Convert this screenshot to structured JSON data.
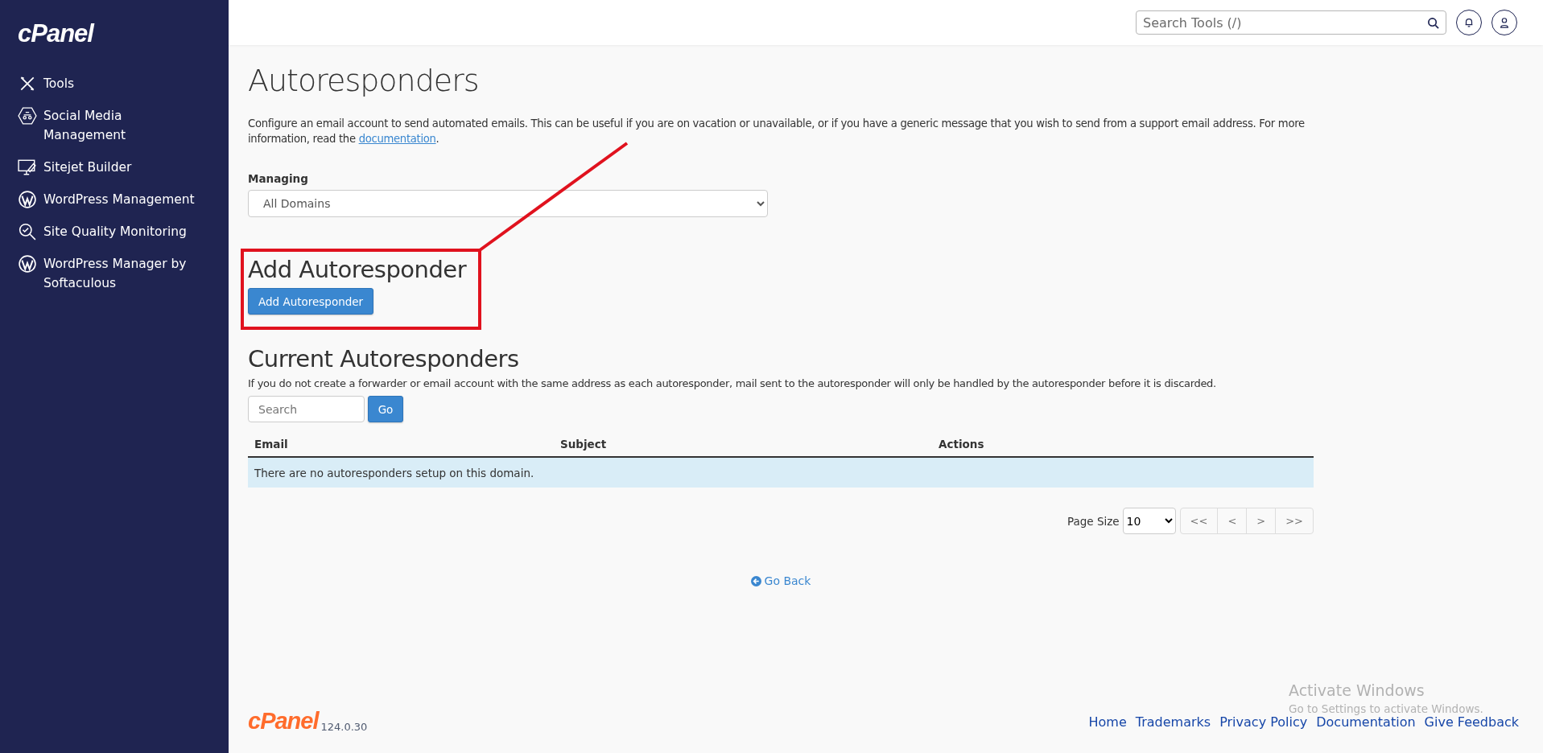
{
  "sidebar": {
    "logo": "cPanel",
    "items": [
      {
        "label": "Tools"
      },
      {
        "label": "Social Media Management"
      },
      {
        "label": "Sitejet Builder"
      },
      {
        "label": "WordPress Management"
      },
      {
        "label": "Site Quality Monitoring"
      },
      {
        "label": "WordPress Manager by Softaculous"
      }
    ]
  },
  "header": {
    "search": {
      "placeholder": "Search Tools (/)"
    }
  },
  "page": {
    "title": "Autoresponders",
    "description": "Configure an email account to send automated emails. This can be useful if you are on vacation or unavailable, or if you have a generic message that you wish to send from a support email address. For more information, read the",
    "description_link": "documentation",
    "description_end": ".",
    "managing": {
      "label": "Managing",
      "value": "All Domains"
    },
    "add_section": {
      "heading": "Add Autoresponder",
      "button": "Add Autoresponder"
    },
    "current_section": {
      "heading": "Current Autoresponders",
      "note": "If you do not create a forwarder or email account with the same address as each autoresponder, mail sent to the autoresponder will only be handled by the autoresponder before it is discarded.",
      "search": {
        "placeholder": "Search",
        "button": "Go"
      },
      "table": {
        "columns": [
          "Email",
          "Subject",
          "Actions"
        ],
        "empty_message": "There are no autoresponders setup on this domain."
      },
      "pagination": {
        "page_size_label": "Page Size",
        "page_size": "10",
        "buttons": [
          "<<",
          "<",
          ">",
          ">>"
        ]
      }
    },
    "go_back": "Go Back"
  },
  "footer": {
    "logo": "cPanel",
    "version": "124.0.30",
    "links": [
      "Home",
      "Trademarks",
      "Privacy Policy",
      "Documentation",
      "Give Feedback"
    ]
  },
  "os_overlay": {
    "title": "Activate Windows",
    "subtitle": "Go to Settings to activate Windows."
  }
}
